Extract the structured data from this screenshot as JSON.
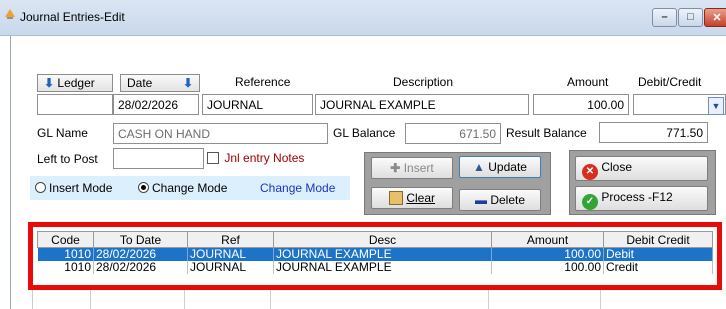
{
  "window": {
    "title": "Journal Entries-Edit"
  },
  "header": {
    "ledger_label": "Ledger",
    "date_label": "Date",
    "reference_label": "Reference",
    "description_label": "Description",
    "amount_label": "Amount",
    "debit_credit_label": "Debit/Credit"
  },
  "entry": {
    "ledger": "",
    "date": "28/02/2026",
    "reference": "JOURNAL",
    "description": "JOURNAL EXAMPLE",
    "amount": "100.00",
    "debit_credit": ""
  },
  "info": {
    "gl_name_label": "GL Name",
    "gl_name": "CASH ON HAND",
    "gl_balance_label": "GL Balance",
    "gl_balance": "671.50",
    "result_balance_label": "Result Balance",
    "result_balance": "771.50",
    "left_to_post_label": "Left to Post",
    "left_to_post": "",
    "jnl_notes_label": "Jnl entry Notes"
  },
  "mode": {
    "insert_label": "Insert Mode",
    "change_label": "Change Mode",
    "selected": "change",
    "current_label": "Change Mode"
  },
  "buttons": {
    "insert": "Insert",
    "update": "Update",
    "clear": "Clear",
    "delete": "Delete",
    "close": "Close",
    "process": "Process -F12"
  },
  "grid": {
    "columns": [
      "Code",
      "To Date",
      "Ref",
      "Desc",
      "Amount",
      "Debit Credit"
    ],
    "rows": [
      {
        "code": "1010",
        "date": "28/02/2026",
        "ref": "JOURNAL",
        "desc": "JOURNAL EXAMPLE",
        "amount": "100.00",
        "dc": "Debit",
        "selected": true
      },
      {
        "code": "1010",
        "date": "28/02/2026",
        "ref": "JOURNAL",
        "desc": "JOURNAL EXAMPLE",
        "amount": "100.00",
        "dc": "Credit",
        "selected": false
      }
    ]
  },
  "colors": {
    "highlight": "#ea0a0a",
    "selection": "#1c73c8",
    "mode_panel": "#dceffd",
    "notes_label": "#a00000",
    "mode_link": "#1a35c8"
  },
  "icons": {
    "window": "app-icon",
    "sort": "arrow-down-icon",
    "insert": "plus-icon",
    "update": "triangle-up-icon",
    "clear": "broom-icon",
    "delete": "minus-icon",
    "close": "red-x-icon",
    "process": "green-check-icon",
    "dropdown": "chevron-down-icon"
  }
}
